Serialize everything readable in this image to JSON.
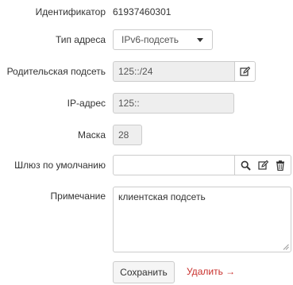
{
  "fields": {
    "identifier": {
      "label": "Идентификатор",
      "value": "61937460301"
    },
    "address_type": {
      "label": "Тип адреса",
      "selected": "IPv6-подсеть"
    },
    "parent_subnet": {
      "label": "Родительская подсеть",
      "value": "125::/24"
    },
    "ip_address": {
      "label": "IP-адрес",
      "value": "125::"
    },
    "mask": {
      "label": "Маска",
      "value": "28"
    },
    "gateway": {
      "label": "Шлюз по умолчанию",
      "value": ""
    },
    "note": {
      "label": "Примечание",
      "value": "клиентская подсеть"
    }
  },
  "actions": {
    "save_label": "Сохранить",
    "delete_label": "Удалить →"
  },
  "icons": {
    "parent_edit": "edit-icon",
    "gateway_search": "search-icon",
    "gateway_edit": "edit-icon",
    "gateway_delete": "trash-icon"
  },
  "colors": {
    "delete_link": "#c9302c",
    "readonly_bg": "#eeeeee",
    "border": "#cccccc"
  }
}
